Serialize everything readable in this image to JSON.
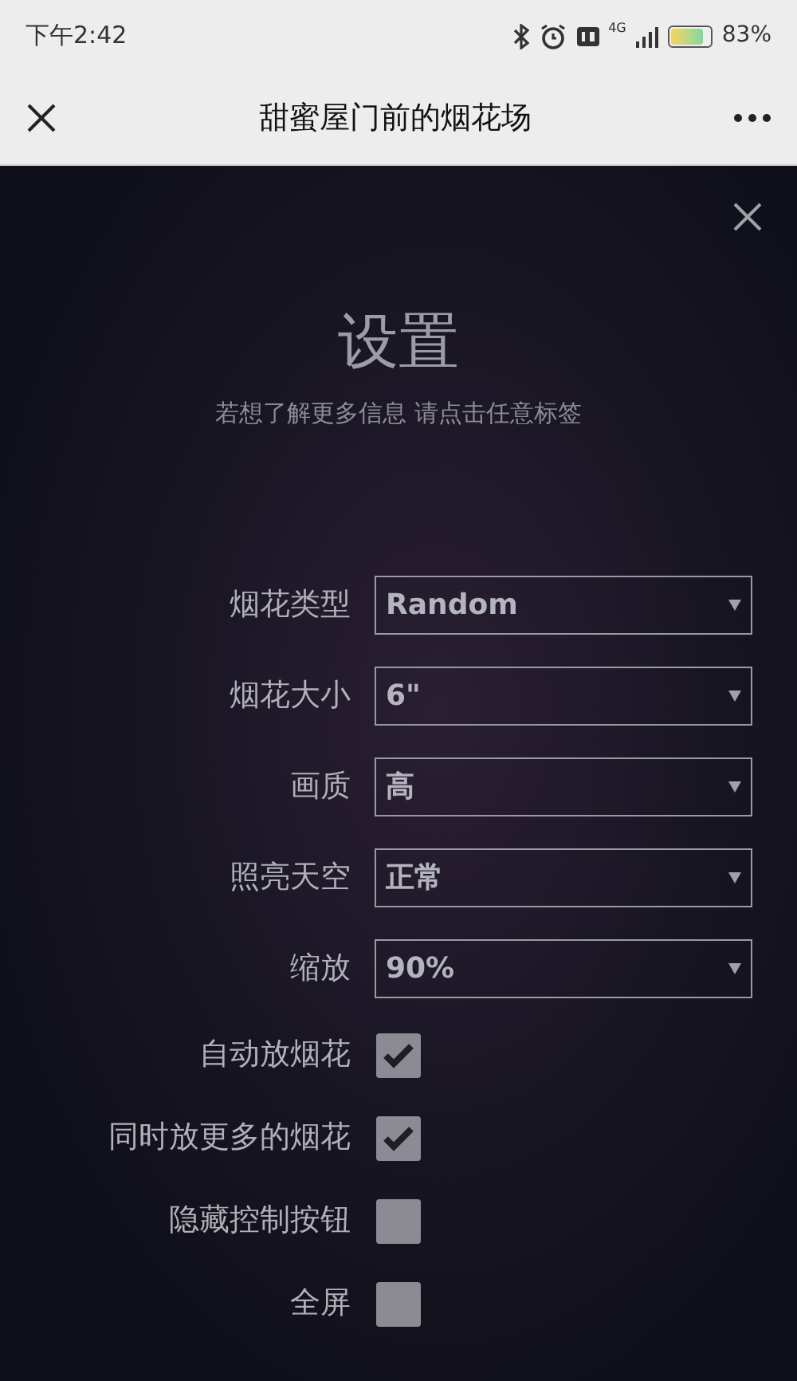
{
  "status_bar": {
    "time": "下午2:42",
    "network": "4G",
    "battery": "83%"
  },
  "nav_bar": {
    "title": "甜蜜屋门前的烟花场"
  },
  "settings": {
    "title": "设置",
    "subtitle": "若想了解更多信息 请点击任意标签",
    "selects": [
      {
        "label": "烟花类型",
        "value": "Random"
      },
      {
        "label": "烟花大小",
        "value": "6\""
      },
      {
        "label": "画质",
        "value": "高"
      },
      {
        "label": "照亮天空",
        "value": "正常"
      },
      {
        "label": "缩放",
        "value": "90%"
      }
    ],
    "checkboxes": [
      {
        "label": "自动放烟花",
        "checked": true
      },
      {
        "label": "同时放更多的烟花",
        "checked": true
      },
      {
        "label": "隐藏控制按钮",
        "checked": false
      },
      {
        "label": "全屏",
        "checked": false
      }
    ]
  }
}
